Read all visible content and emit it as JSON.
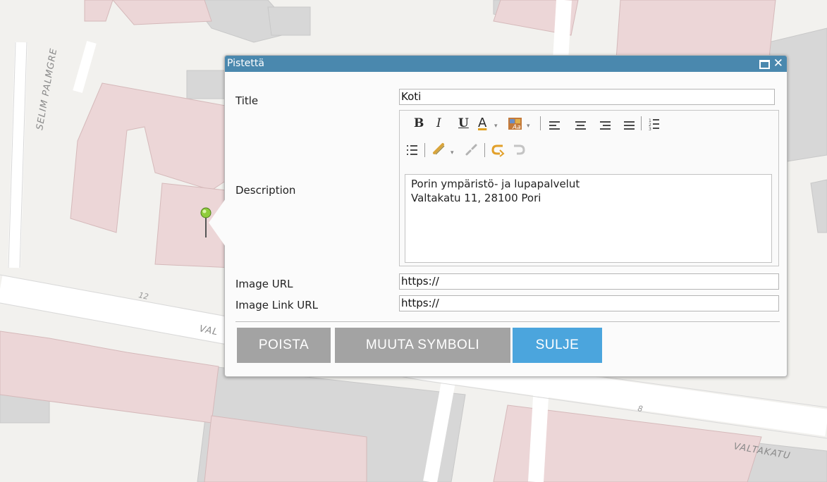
{
  "map": {
    "street_labels": [
      "SELIM PALMGRE",
      "VAL",
      "VALTAKATU"
    ],
    "address_numbers": [
      "12",
      "8"
    ]
  },
  "popup": {
    "title": "Pistettä",
    "fields": {
      "title_label": "Title",
      "title_value": "Koti",
      "description_label": "Description",
      "description_lines": [
        "Porin ympäristö- ja lupapalvelut",
        "Valtakatu 11, 28100 Pori"
      ],
      "image_url_label": "Image URL",
      "image_url_value": "https://",
      "image_link_url_label": "Image Link URL",
      "image_link_url_value": "https://"
    },
    "toolbar": {
      "bold": "B",
      "italic": "I",
      "underline": "U",
      "font_color": "A",
      "caret": "▾"
    },
    "buttons": {
      "delete": "POISTA",
      "change_symbol": "MUUTA SYMBOLI",
      "close": "SULJE"
    }
  },
  "colors": {
    "titlebar": "#4a88ae",
    "primary_button": "#4ba5dd",
    "secondary_button": "#a3a3a3",
    "building": "#ebd5d6",
    "road": "#ffffff"
  }
}
